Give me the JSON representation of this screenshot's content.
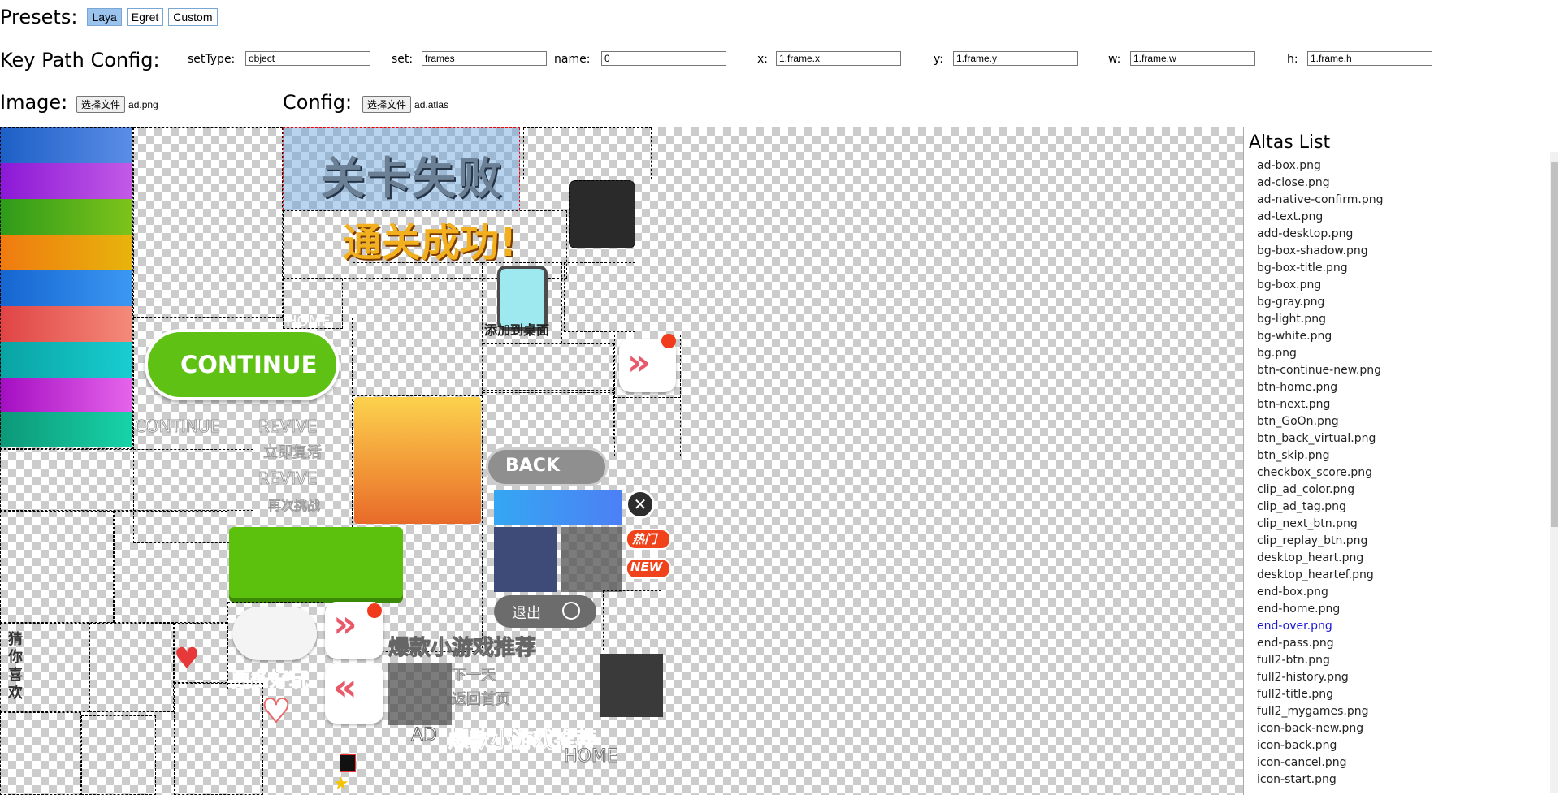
{
  "presets": {
    "label": "Presets:",
    "buttons": [
      "Laya",
      "Egret",
      "Custom"
    ],
    "active": "Laya"
  },
  "keypath": {
    "label": "Key Path Config:",
    "fields": [
      {
        "label": "setType:",
        "value": "object"
      },
      {
        "label": "set:",
        "value": "frames"
      },
      {
        "label": "name:",
        "value": "0"
      },
      {
        "label": "x:",
        "value": "1.frame.x"
      },
      {
        "label": "y:",
        "value": "1.frame.y"
      },
      {
        "label": "w:",
        "value": "1.frame.w"
      },
      {
        "label": "h:",
        "value": "1.frame.h"
      }
    ]
  },
  "image": {
    "label": "Image:",
    "button": "选择文件",
    "file": "ad.png"
  },
  "config": {
    "label": "Config:",
    "button": "选择文件",
    "file": "ad.atlas"
  },
  "atlas_texts": {
    "fail": "关卡失败",
    "pass": "通关成功!",
    "continue": "CONTINUE",
    "continue_outline": "CONTINUE",
    "revive": "REVIVE",
    "revive2": "REVIVE",
    "revive_cn": "立即复活",
    "retry": "再次挑战",
    "home": "HOME",
    "add_desktop": "添加到桌面",
    "back": "BACK",
    "hot": "热门",
    "new": "NEW",
    "exit": "退出",
    "more": "更多好玩",
    "guess": "猜你喜欢",
    "recommend": "爆款小游戏推荐",
    "recommend2": "爆款小游戏推荐",
    "ad": "AD",
    "next_day": "下一天",
    "return_home": "返回首页",
    "home2": "HOME"
  },
  "sidebar": {
    "title": "Altas List",
    "items": [
      "ad-box.png",
      "ad-close.png",
      "ad-native-confirm.png",
      "ad-text.png",
      "add-desktop.png",
      "bg-box-shadow.png",
      "bg-box-title.png",
      "bg-box.png",
      "bg-gray.png",
      "bg-light.png",
      "bg-white.png",
      "bg.png",
      "btn-continue-new.png",
      "btn-home.png",
      "btn-next.png",
      "btn_GoOn.png",
      "btn_back_virtual.png",
      "btn_skip.png",
      "checkbox_score.png",
      "clip_ad_color.png",
      "clip_ad_tag.png",
      "clip_next_btn.png",
      "clip_replay_btn.png",
      "desktop_heart.png",
      "desktop_heartef.png",
      "end-box.png",
      "end-home.png",
      "end-over.png",
      "end-pass.png",
      "full2-btn.png",
      "full2-history.png",
      "full2-title.png",
      "full2_mygames.png",
      "icon-back-new.png",
      "icon-back.png",
      "icon-cancel.png",
      "icon-start.png"
    ],
    "active_index": 27
  }
}
